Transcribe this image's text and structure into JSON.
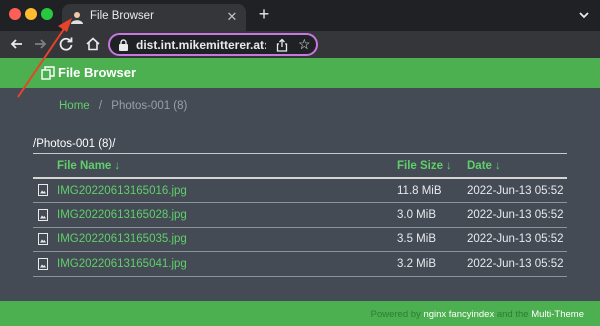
{
  "browser": {
    "tab_title": "File Browser",
    "url": "dist.int.mikemitterer.at:..."
  },
  "header": {
    "title": "File Browser"
  },
  "breadcrumb": {
    "home": "Home",
    "separator": "/",
    "current": "Photos-001 (8)"
  },
  "path_title": "/Photos-001 (8)/",
  "table": {
    "col_name": "File Name",
    "col_size": "File Size",
    "col_date": "Date",
    "sort_arrow": "↓",
    "rows": [
      {
        "name": "IMG20220613165016.jpg",
        "size": "11.8 MiB",
        "date": "2022-Jun-13 05:52"
      },
      {
        "name": "IMG20220613165028.jpg",
        "size": "3.0 MiB",
        "date": "2022-Jun-13 05:52"
      },
      {
        "name": "IMG20220613165035.jpg",
        "size": "3.5 MiB",
        "date": "2022-Jun-13 05:52"
      },
      {
        "name": "IMG20220613165041.jpg",
        "size": "3.2 MiB",
        "date": "2022-Jun-13 05:52"
      }
    ]
  },
  "footer": {
    "powered_by": "Powered by",
    "nginx": "nginx",
    "fancyindex": "fancyindex",
    "and_the": "and the",
    "theme": "Multi-Theme"
  },
  "colors": {
    "accent_green": "#4caf50",
    "link_green": "#5fd06a",
    "page_bg": "#444b55",
    "omnibox_border": "#c777e0",
    "annotation_arrow": "#e8432a"
  },
  "icons": {
    "tab_favicon": "user-avatar-icon",
    "back": "arrow-left-icon",
    "forward": "arrow-right-icon",
    "reload": "reload-icon",
    "home": "home-icon",
    "lock": "lock-icon",
    "share": "share-icon",
    "star": "star-icon",
    "header": "copy-files-icon",
    "file": "image-file-icon"
  }
}
